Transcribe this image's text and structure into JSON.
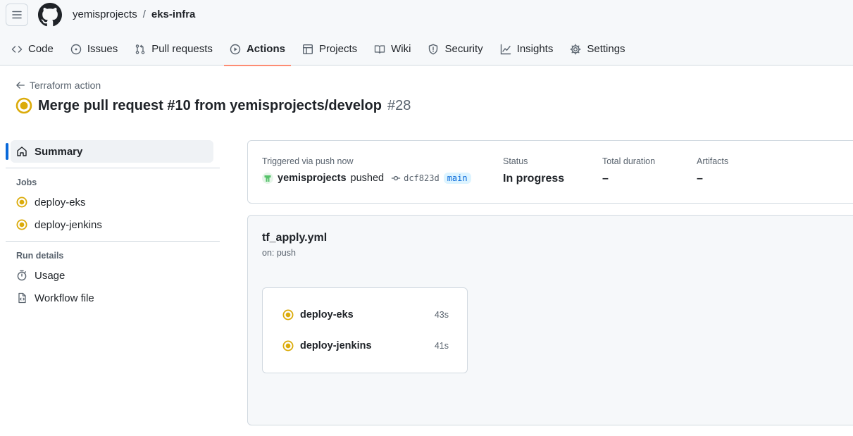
{
  "repo": {
    "owner": "yemisprojects",
    "separator": "/",
    "name": "eks-infra"
  },
  "tabs": [
    {
      "label": "Code",
      "icon": "code-icon"
    },
    {
      "label": "Issues",
      "icon": "issue-icon"
    },
    {
      "label": "Pull requests",
      "icon": "pull-request-icon"
    },
    {
      "label": "Actions",
      "icon": "play-icon"
    },
    {
      "label": "Projects",
      "icon": "table-icon"
    },
    {
      "label": "Wiki",
      "icon": "book-icon"
    },
    {
      "label": "Security",
      "icon": "shield-icon"
    },
    {
      "label": "Insights",
      "icon": "graph-icon"
    },
    {
      "label": "Settings",
      "icon": "gear-icon"
    }
  ],
  "run": {
    "back_label": "Terraform action",
    "title": "Merge pull request #10 from yemisprojects/develop",
    "number": "#28"
  },
  "sidebar": {
    "summary_label": "Summary",
    "jobs_heading": "Jobs",
    "jobs": [
      "deploy-eks",
      "deploy-jenkins"
    ],
    "run_details_heading": "Run details",
    "usage_label": "Usage",
    "workflow_file_label": "Workflow file"
  },
  "summary": {
    "trigger_label": "Triggered via push now",
    "actor": "yemisprojects",
    "action": "pushed",
    "commit": "dcf823d",
    "branch": "main",
    "status_label": "Status",
    "status_value": "In progress",
    "duration_label": "Total duration",
    "duration_value": "–",
    "artifacts_label": "Artifacts",
    "artifacts_value": "–"
  },
  "workflow": {
    "file": "tf_apply.yml",
    "on": "on: push",
    "jobs": [
      {
        "name": "deploy-eks",
        "duration": "43s"
      },
      {
        "name": "deploy-jenkins",
        "duration": "41s"
      }
    ]
  },
  "colors": {
    "accent": "#0969da",
    "tab_underline": "#fd8c73",
    "in_progress": "#dbab0a"
  }
}
